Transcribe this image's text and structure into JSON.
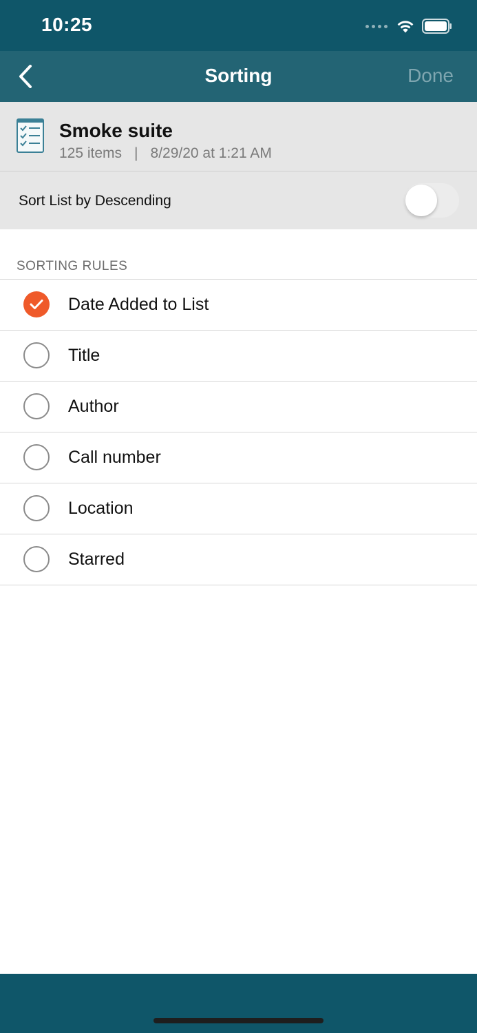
{
  "status_bar": {
    "time": "10:25"
  },
  "nav": {
    "title": "Sorting",
    "done_label": "Done"
  },
  "list": {
    "name": "Smoke suite",
    "item_count": "125 items",
    "separator": "|",
    "date": "8/29/20 at 1:21 AM"
  },
  "toggle": {
    "label": "Sort List by Descending",
    "on": false
  },
  "sorting": {
    "section_title": "SORTING RULES",
    "rules": [
      {
        "label": "Date Added to List",
        "selected": true
      },
      {
        "label": "Title",
        "selected": false
      },
      {
        "label": "Author",
        "selected": false
      },
      {
        "label": "Call number",
        "selected": false
      },
      {
        "label": "Location",
        "selected": false
      },
      {
        "label": "Starred",
        "selected": false
      }
    ]
  },
  "colors": {
    "status_bar": "#0f5669",
    "nav_bar": "#236474",
    "accent": "#ef5a2a"
  },
  "icons": [
    "chevron-left-icon",
    "checklist-icon",
    "wifi-icon",
    "battery-icon",
    "checkmark-icon"
  ]
}
